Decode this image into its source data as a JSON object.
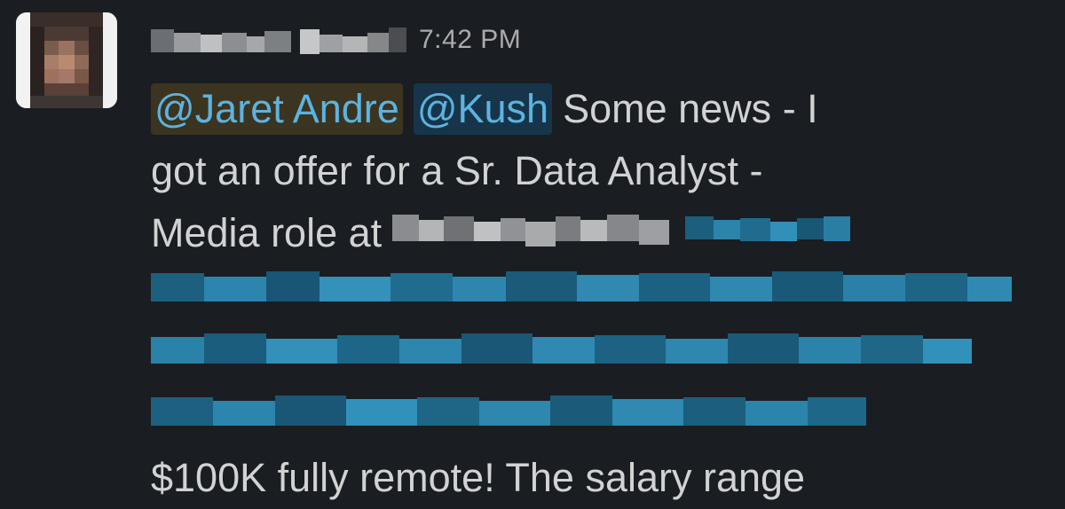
{
  "message": {
    "author_name": "[redacted]",
    "timestamp": "7:42 PM",
    "mentions": [
      "@Jaret Andre",
      "@Kush"
    ],
    "line1_text": "Some news - I",
    "line2_text": "got an offer for a Sr. Data Analyst -",
    "line3_text": "Media role at",
    "company": "[redacted]",
    "link": "[redacted link]",
    "line_last": "$100K fully remote! The salary range"
  },
  "colors": {
    "background": "#1a1d21",
    "text": "#d1d2d3",
    "timestamp": "#ababad",
    "mention_text": "#5cb3e0",
    "mention_amber_bg": "#3b3420",
    "mention_blue_bg": "#17354a",
    "link": "#1d9bd1"
  },
  "icons": {
    "avatar": "user-avatar-pixelated"
  }
}
